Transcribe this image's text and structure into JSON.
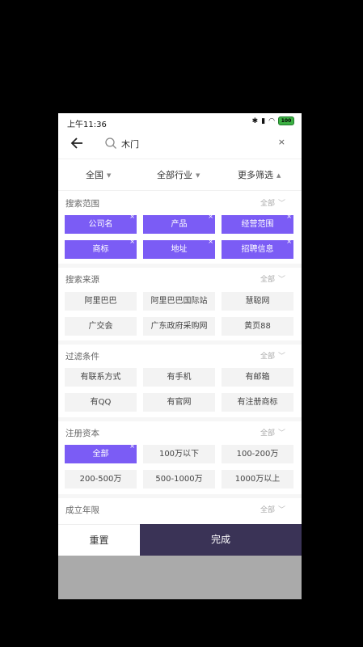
{
  "status_bar": {
    "time": "上午11:36",
    "battery": "100"
  },
  "search": {
    "query": "木门",
    "clear": "×"
  },
  "filter_bar": {
    "region": "全国",
    "industry": "全部行业",
    "more": "更多筛选"
  },
  "sections": {
    "scope": {
      "title": "搜索范围",
      "right": "全部",
      "chips": [
        "公司名",
        "产品",
        "经营范围",
        "商标",
        "地址",
        "招聘信息"
      ]
    },
    "source": {
      "title": "搜索来源",
      "right": "全部",
      "chips": [
        "阿里巴巴",
        "阿里巴巴国际站",
        "慧聪网",
        "广交会",
        "广东政府采购网",
        "黄页88"
      ]
    },
    "conditions": {
      "title": "过滤条件",
      "right": "全部",
      "chips": [
        "有联系方式",
        "有手机",
        "有邮箱",
        "有QQ",
        "有官网",
        "有注册商标"
      ]
    },
    "capital": {
      "title": "注册资本",
      "right": "全部",
      "chips": [
        "全部",
        "100万以下",
        "100-200万",
        "200-500万",
        "500-1000万",
        "1000万以上"
      ]
    },
    "years": {
      "title": "成立年限",
      "right": "全部"
    }
  },
  "actions": {
    "reset": "重置",
    "done": "完成"
  },
  "colors": {
    "accent": "#7b5cf5",
    "done_bg": "#3a3356"
  }
}
